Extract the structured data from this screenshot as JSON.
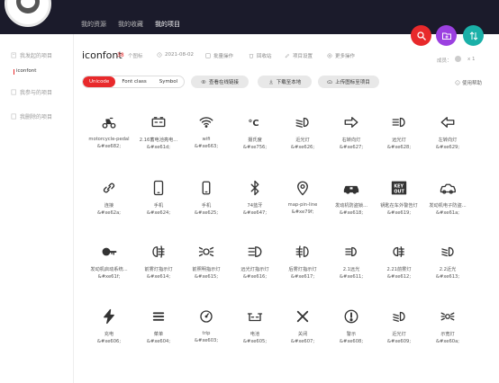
{
  "topnav": {
    "items": [
      {
        "label": "我的资源",
        "active": false
      },
      {
        "label": "我的收藏",
        "active": false
      },
      {
        "label": "我的项目",
        "active": true
      }
    ]
  },
  "sidebar": {
    "my_projects": "我发起的项目",
    "current_project": "iconfont",
    "joined_projects": "我参与的项目",
    "deleted_projects": "我删除的项目"
  },
  "project": {
    "title": "iconfont",
    "count": "38",
    "count_label": "个图标",
    "date": "2021-08-02",
    "batch_label": "批量操作",
    "recycle_label": "回收站",
    "settings_label": "项目设置",
    "more_label": "更多操作",
    "members_label": "成员：",
    "members_count": "x 1"
  },
  "toolbar": {
    "tabs": [
      {
        "label": "Unicode",
        "active": true
      },
      {
        "label": "Font class",
        "active": false
      },
      {
        "label": "Symbol",
        "active": false
      }
    ],
    "online_link": "查看在线链接",
    "download": "下载至本地",
    "upload": "上传图标至项目",
    "help": "使用帮助"
  },
  "icons": [
    {
      "name": "motorcycle-pedal",
      "code": "&#xe682;",
      "icon": "motorcycle-icon"
    },
    {
      "name": "2.16蓄电池亮电...",
      "code": "&#xe61d;",
      "icon": "battery-icon"
    },
    {
      "name": "wifi",
      "code": "&#xe663;",
      "icon": "wifi-icon"
    },
    {
      "name": "摄氏度",
      "code": "&#xe756;",
      "icon": "celsius-icon"
    },
    {
      "name": "近光灯",
      "code": "&#xe626;",
      "icon": "low-beam-icon"
    },
    {
      "name": "右转向灯",
      "code": "&#xe627;",
      "icon": "right-arrow-icon"
    },
    {
      "name": "远光灯",
      "code": "&#xe628;",
      "icon": "high-beam-icon"
    },
    {
      "name": "左转向灯",
      "code": "&#xe629;",
      "icon": "left-arrow-icon"
    },
    {
      "name": "连接",
      "code": "&#xe62a;",
      "icon": "link-icon"
    },
    {
      "name": "手机",
      "code": "&#xe624;",
      "icon": "phone-icon"
    },
    {
      "name": "手机",
      "code": "&#xe625;",
      "icon": "phone-small-icon"
    },
    {
      "name": "74蓝牙",
      "code": "&#xe647;",
      "icon": "bluetooth-icon"
    },
    {
      "name": "map-pin-line",
      "code": "&#xe79f;",
      "icon": "map-pin-icon"
    },
    {
      "name": "发动机防盗锁...",
      "code": "&#xe618;",
      "icon": "car-lock-icon"
    },
    {
      "name": "钥匙在车外警告灯",
      "code": "&#xe619;",
      "icon": "key-out-icon"
    },
    {
      "name": "发动机电子防盗...",
      "code": "&#xe61a;",
      "icon": "car-outline-icon"
    },
    {
      "name": "发动机启动系统...",
      "code": "&#xe61f;",
      "icon": "engine-key-icon"
    },
    {
      "name": "前雾灯指示灯",
      "code": "&#xe614;",
      "icon": "front-fog-icon"
    },
    {
      "name": "前照明指示灯",
      "code": "&#xe615;",
      "icon": "parking-light-icon"
    },
    {
      "name": "远光灯指示灯",
      "code": "&#xe616;",
      "icon": "high-beam-indicator-icon"
    },
    {
      "name": "后雾灯指示灯",
      "code": "&#xe617;",
      "icon": "rear-fog-icon"
    },
    {
      "name": "2.1远光",
      "code": "&#xe611;",
      "icon": "high-beam-2-icon"
    },
    {
      "name": "2.21前雾灯",
      "code": "&#xe612;",
      "icon": "fog-2-icon"
    },
    {
      "name": "2.2近光",
      "code": "&#xe613;",
      "icon": "low-beam-2-icon"
    },
    {
      "name": "充电",
      "code": "&#xe606;",
      "icon": "charge-icon"
    },
    {
      "name": "菜单",
      "code": "&#xe604;",
      "icon": "menu-icon"
    },
    {
      "name": "trip",
      "code": "&#xe603;",
      "icon": "trip-icon"
    },
    {
      "name": "电池",
      "code": "&#xe605;",
      "icon": "battery-level-icon"
    },
    {
      "name": "关闭",
      "code": "&#xe607;",
      "icon": "close-icon"
    },
    {
      "name": "警示",
      "code": "&#xe608;",
      "icon": "warning-icon"
    },
    {
      "name": "近光灯",
      "code": "&#xe609;",
      "icon": "low-beam-3-icon"
    },
    {
      "name": "示宽灯",
      "code": "&#xe60a;",
      "icon": "width-light-icon"
    }
  ],
  "colors": {
    "accent": "#e8292b",
    "topbar": "#1b1b2b",
    "fab_purple": "#9b40e0",
    "fab_teal": "#1ab0a8"
  }
}
